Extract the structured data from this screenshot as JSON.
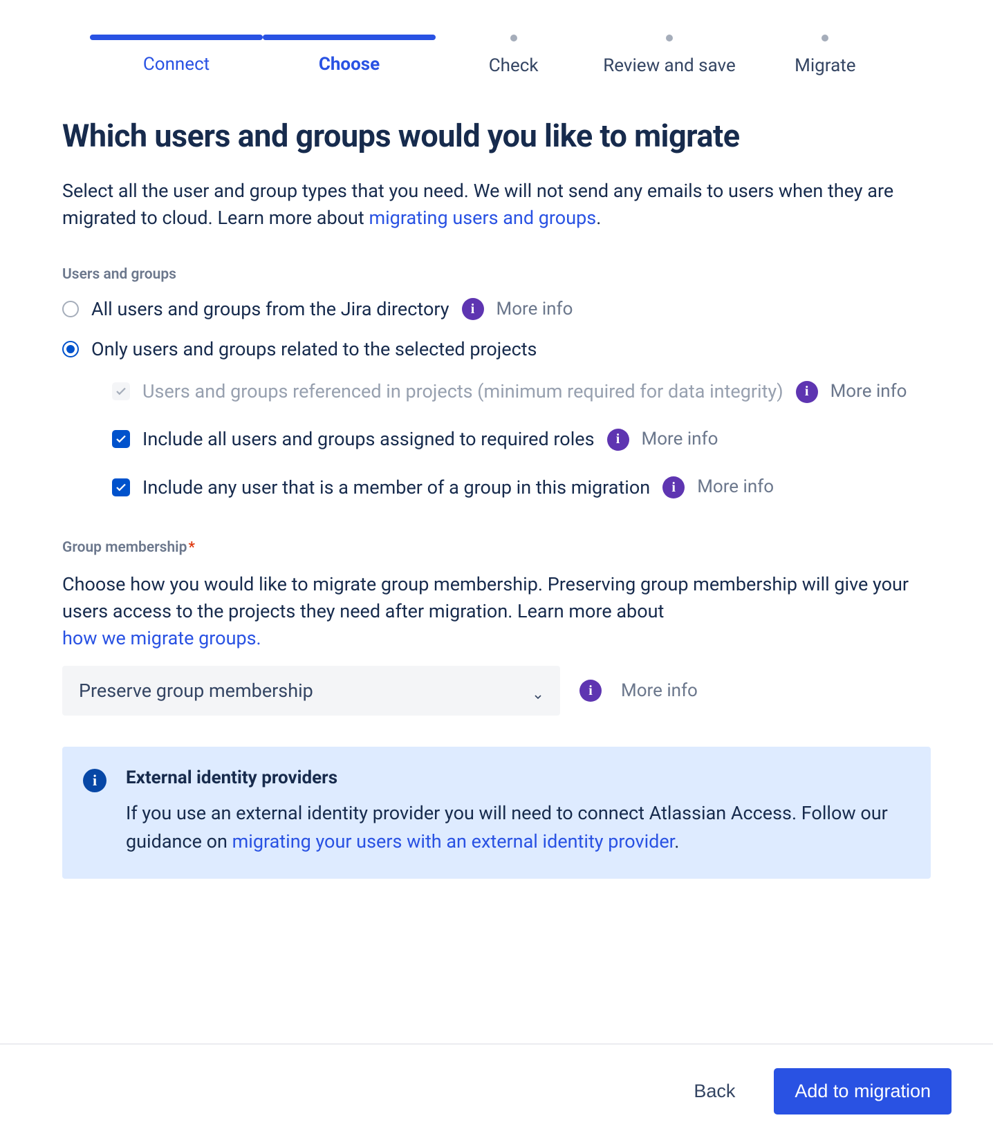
{
  "stepper": {
    "steps": [
      "Connect",
      "Choose",
      "Check",
      "Review and save",
      "Migrate"
    ],
    "done_index": 0,
    "active_index": 1
  },
  "page": {
    "title": "Which users and groups would you like to migrate",
    "intro_prefix": "Select all the user and group types that you need. We will not send any emails to users when they are migrated to cloud. Learn more about ",
    "intro_link": "migrating users and groups",
    "intro_suffix": "."
  },
  "users_groups": {
    "section_label": "Users and groups",
    "more_info_label": "More info",
    "options": {
      "all": "All users and groups from the Jira directory",
      "only_related": "Only users and groups related to the selected projects"
    },
    "sub": {
      "referenced": "Users and groups referenced in projects (minimum required for data integrity)",
      "include_roles": "Include all users and groups assigned to required roles",
      "include_members": "Include any user that is a member of a group in this migration"
    }
  },
  "group_membership": {
    "section_label": "Group membership",
    "desc_prefix": "Choose how you would like to migrate group membership. Preserving group membership will give your users access to the projects they need after migration. Learn more about ",
    "desc_link": "how we migrate groups.",
    "dropdown_value": "Preserve group membership",
    "more_info_label": "More info"
  },
  "banner": {
    "title": "External identity providers",
    "body_prefix": "If you use an external identity provider you will need to connect Atlassian Access. Follow our guidance on ",
    "body_link": "migrating your users with an external identity provider",
    "body_suffix": "."
  },
  "footer": {
    "back": "Back",
    "primary": "Add to migration"
  }
}
